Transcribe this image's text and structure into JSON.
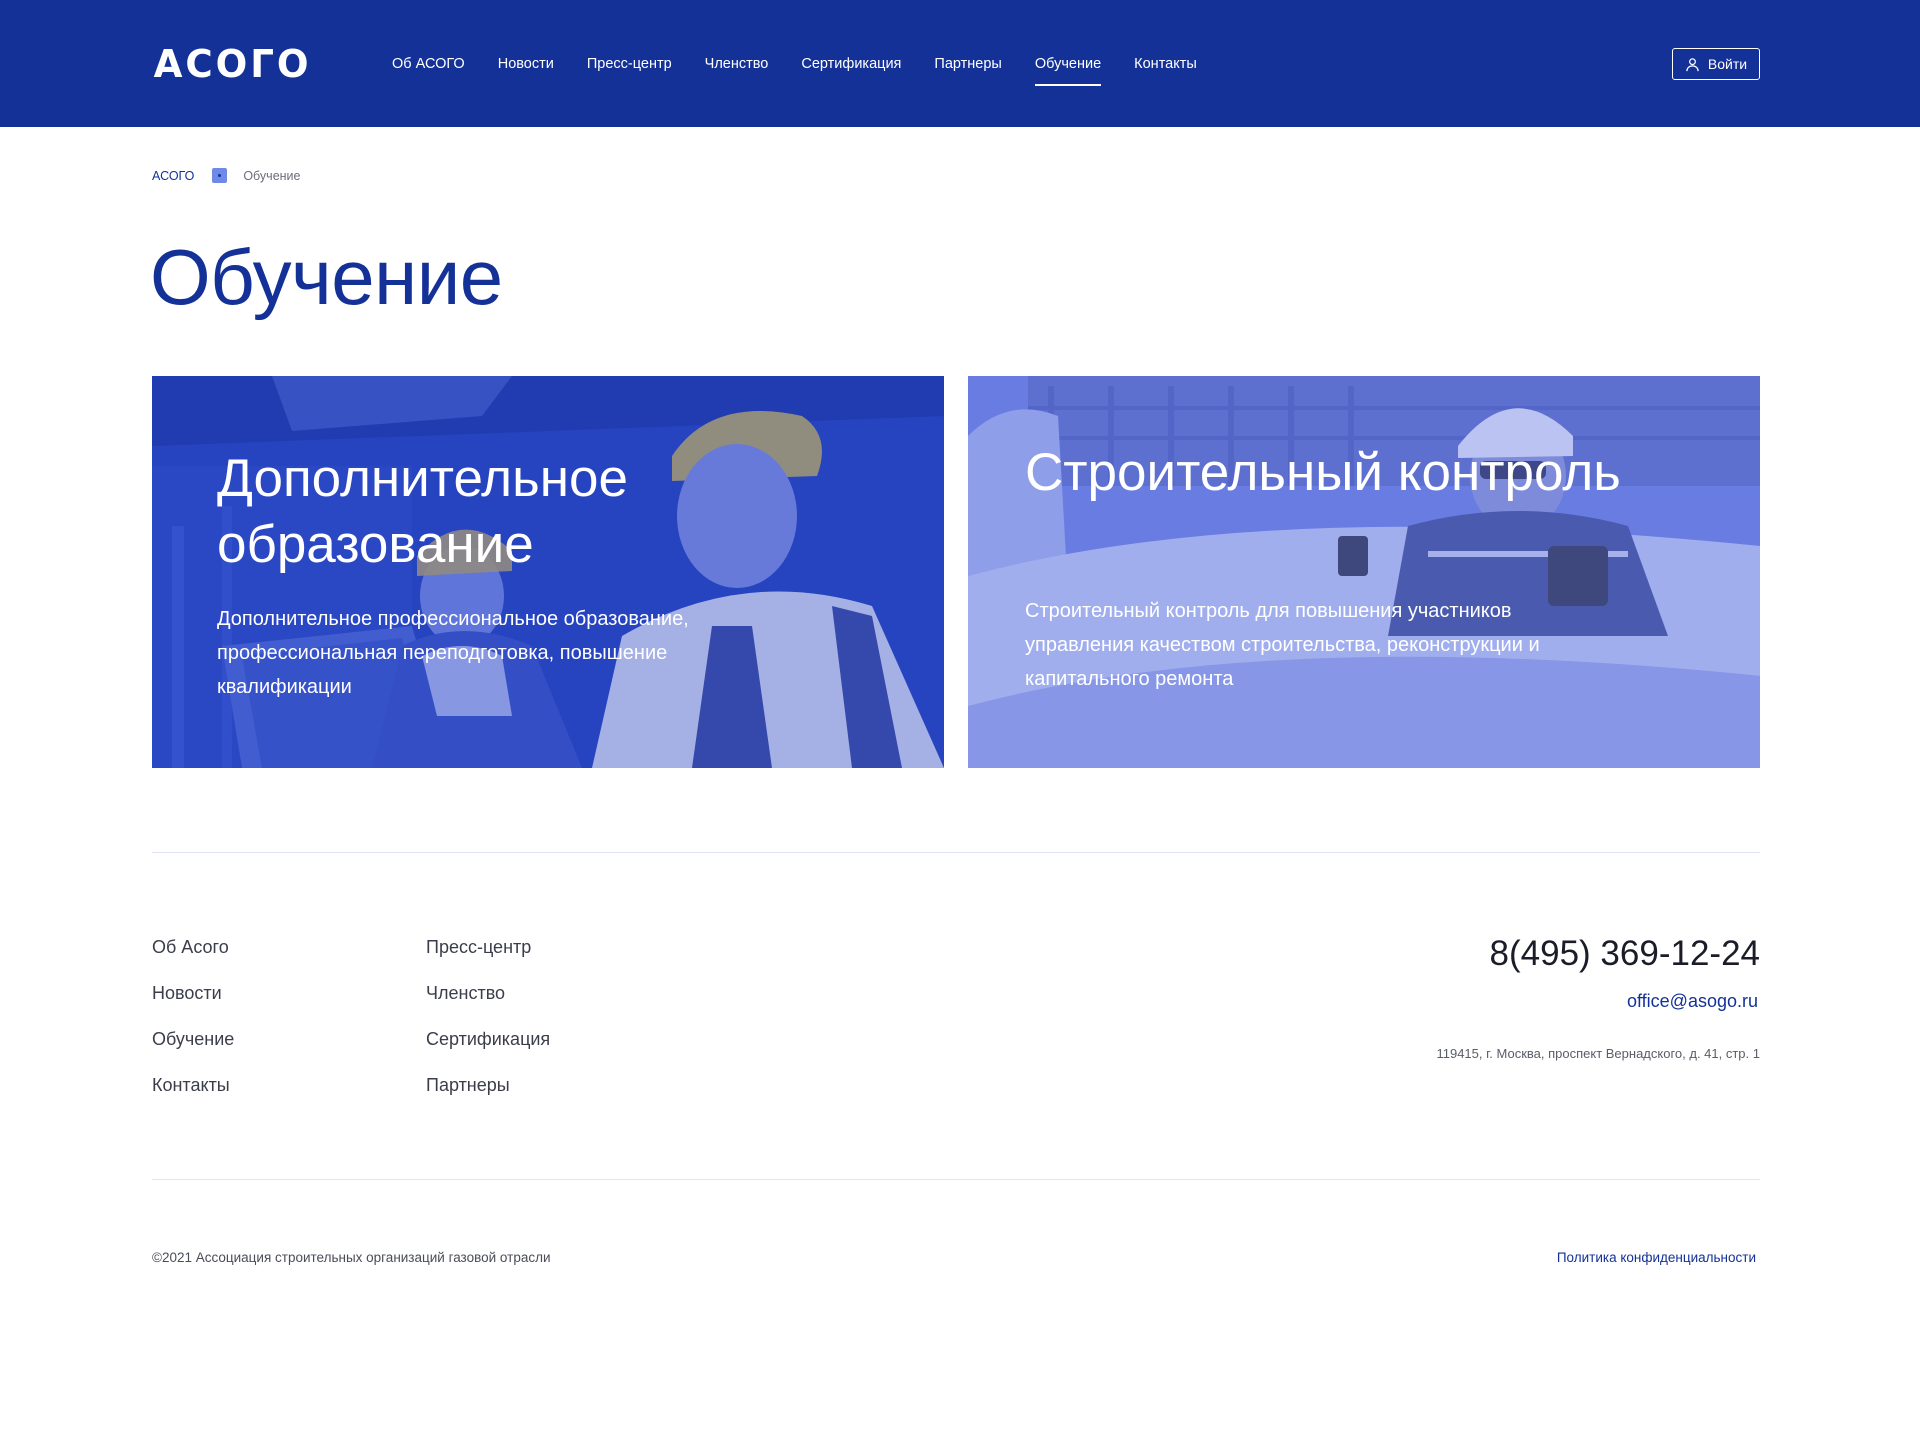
{
  "header": {
    "logo": "АСОГО",
    "nav": [
      "Об АСОГО",
      "Новости",
      "Пресс-центр",
      "Членство",
      "Сертификация",
      "Партнеры",
      "Обучение",
      "Контакты"
    ],
    "active_nav": "Обучение",
    "login_label": "Войти",
    "bg_color": "#133197"
  },
  "breadcrumb": {
    "home": "АСОГО",
    "current": "Обучение"
  },
  "page": {
    "title": "Обучение"
  },
  "cards": [
    {
      "title": "Дополнительное образование",
      "description": "Дополнительное профессиональное образование, профессиональная переподготовка, повышение квалификации"
    },
    {
      "title": "Строительный контроль",
      "description": "Строительный контроль для повышения участников управления качеством строительства, реконструкции и капитального ремонта"
    }
  ],
  "footer": {
    "col1": [
      "Об Асого",
      "Новости",
      "Обучение",
      "Контакты"
    ],
    "col2": [
      "Пресс-центр",
      "Членство",
      "Сертификация",
      "Партнеры"
    ],
    "phone": "8(495) 369-12-24",
    "email": "office@asogo.ru",
    "address": "119415, г. Москва, проспект Вернадского, д. 41, стр. 1",
    "copyright": "©2021 Ассоциация строительных организаций газовой отрасли",
    "privacy": "Политика конфиденциальности"
  },
  "colors": {
    "accent": "#133197",
    "card1_overlay": "#2a46c4",
    "card2_overlay": "#6478e0"
  }
}
